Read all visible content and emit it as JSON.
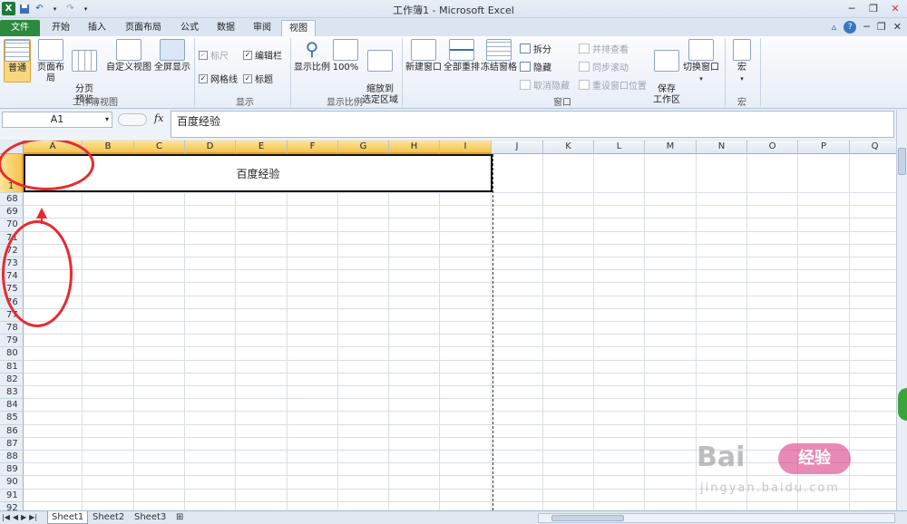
{
  "window": {
    "title": "工作簿1 - Microsoft Excel",
    "app_icon": "X"
  },
  "ribbon_tabs": [
    "文件",
    "开始",
    "插入",
    "页面布局",
    "公式",
    "数据",
    "审阅",
    "视图"
  ],
  "ribbon": {
    "workbook_views": {
      "normal": "普通",
      "page_layout": "页面布局",
      "page_break_preview": "分页\n预览",
      "custom_views": "自定义视图",
      "full_screen": "全屏显示",
      "label": "工作簿视图"
    },
    "show": {
      "ruler": "标尺",
      "formula_bar": "编辑栏",
      "gridlines": "网格线",
      "headings": "标题",
      "label": "显示"
    },
    "zoom": {
      "zoom": "显示比例",
      "hundred": "100%",
      "zoom_to_selection": "缩放到\n选定区域",
      "label": "显示比例"
    },
    "window": {
      "new_window": "新建窗口",
      "arrange_all": "全部重排",
      "freeze_panes": "冻结窗格",
      "split": "拆分",
      "hide": "隐藏",
      "unhide": "取消隐藏",
      "view_side_by_side": "并排查看",
      "synchronous_scrolling": "同步滚动",
      "reset_window_position": "重设窗口位置",
      "save_workspace": "保存\n工作区",
      "switch_windows": "切换窗口",
      "label": "窗口"
    },
    "macros": {
      "macros": "宏",
      "label": "宏"
    }
  },
  "formula_bar": {
    "name_box": "A1",
    "fx": "fx",
    "content": "百度经验"
  },
  "sheet": {
    "columns": [
      "A",
      "B",
      "C",
      "D",
      "E",
      "F",
      "G",
      "H",
      "I",
      "J",
      "K",
      "L",
      "M",
      "N",
      "O",
      "P",
      "Q"
    ],
    "selected_columns": [
      "A",
      "B",
      "C",
      "D",
      "E",
      "F",
      "G",
      "H",
      "I"
    ],
    "rows": [
      "1",
      "68",
      "69",
      "70",
      "71",
      "72",
      "73",
      "74",
      "75",
      "76",
      "77",
      "78",
      "79",
      "80",
      "81",
      "82",
      "83",
      "84",
      "85",
      "86",
      "87",
      "88",
      "89",
      "90",
      "91",
      "92"
    ],
    "merged_cell_text": "百度经验"
  },
  "sheet_tabs": [
    "Sheet1",
    "Sheet2",
    "Sheet3"
  ],
  "watermark": {
    "brand": "Bai",
    "badge": "经验",
    "url": "jingyan.baidu.com"
  },
  "colors": {
    "file_tab": "#2a8a3d",
    "selection_header": "#f6c24d",
    "annotation_red": "#e82a2f"
  }
}
